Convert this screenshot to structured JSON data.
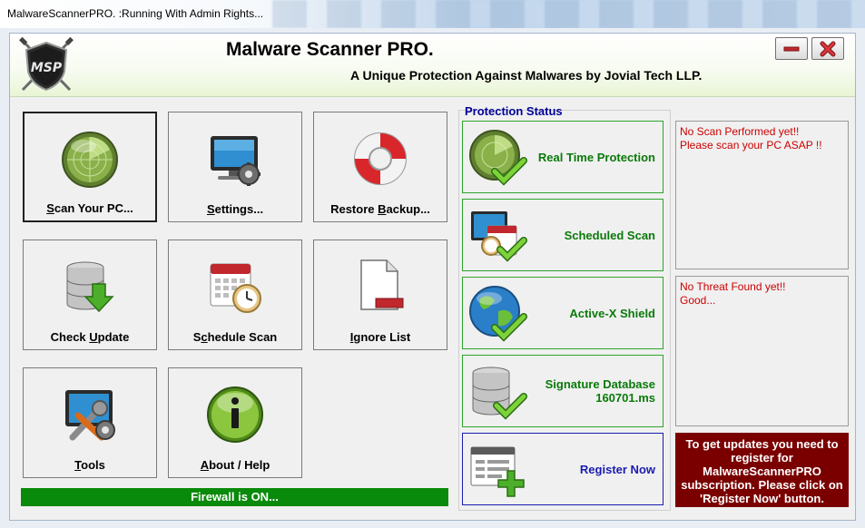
{
  "window": {
    "title": "MalwareScannerPRO. :Running With Admin Rights..."
  },
  "header": {
    "logo_text": "MSP",
    "app_title": "Malware Scanner PRO.",
    "subtitle": "A Unique Protection Against Malwares by Jovial Tech LLP."
  },
  "tiles": [
    {
      "id": "scan",
      "label_pre": "",
      "label_u": "S",
      "label_post": "can Your PC...",
      "icon": "radar-icon",
      "selected": true
    },
    {
      "id": "settings",
      "label_pre": "",
      "label_u": "S",
      "label_post": "ettings...",
      "icon": "monitor-gear-icon"
    },
    {
      "id": "restore",
      "label_pre": "Restore ",
      "label_u": "B",
      "label_post": "ackup...",
      "icon": "lifebuoy-icon"
    },
    {
      "id": "update",
      "label_pre": "Check ",
      "label_u": "U",
      "label_post": "pdate",
      "icon": "database-download-icon"
    },
    {
      "id": "schedule",
      "label_pre": "S",
      "label_u": "c",
      "label_post": "hedule Scan",
      "icon": "calendar-clock-icon"
    },
    {
      "id": "ignore",
      "label_pre": "",
      "label_u": "I",
      "label_post": "gnore List",
      "icon": "document-minus-icon"
    },
    {
      "id": "tools",
      "label_pre": "",
      "label_u": "T",
      "label_post": "ools",
      "icon": "wrench-screwdriver-icon"
    },
    {
      "id": "about",
      "label_pre": "",
      "label_u": "A",
      "label_post": "bout / Help",
      "icon": "info-icon"
    }
  ],
  "firewall_status": "Firewall is ON...",
  "protection": {
    "group_label": "Protection Status",
    "items": [
      {
        "id": "realtime",
        "label_line1": "Real Time Protection",
        "label_line2": "",
        "icon": "radar-check-icon"
      },
      {
        "id": "scheduled",
        "label_line1": "Scheduled Scan",
        "label_line2": "",
        "icon": "calendar-check-icon"
      },
      {
        "id": "activex",
        "label_line1": "Active-X Shield",
        "label_line2": "",
        "icon": "globe-check-icon"
      },
      {
        "id": "signature",
        "label_line1": "Signature Database",
        "label_line2": "160701.ms",
        "icon": "database-check-icon"
      },
      {
        "id": "register",
        "label_line1": "Register Now",
        "label_line2": "",
        "icon": "form-plus-icon"
      }
    ]
  },
  "messages": {
    "scan_line1": "No Scan Performed yet!!",
    "scan_line2": "Please scan your PC ASAP !!",
    "threat_line1": "No Threat Found yet!!",
    "threat_line2": "Good..."
  },
  "register_notice": "To get updates you need to register for MalwareScannerPRO subscription. Please click on 'Register Now' button.",
  "colors": {
    "firewall_green": "#0a8a0a",
    "status_green": "#0a7a0a",
    "link_blue": "#1b1bb0",
    "alert_red": "#cc0000",
    "notice_maroon": "#7a0000"
  }
}
